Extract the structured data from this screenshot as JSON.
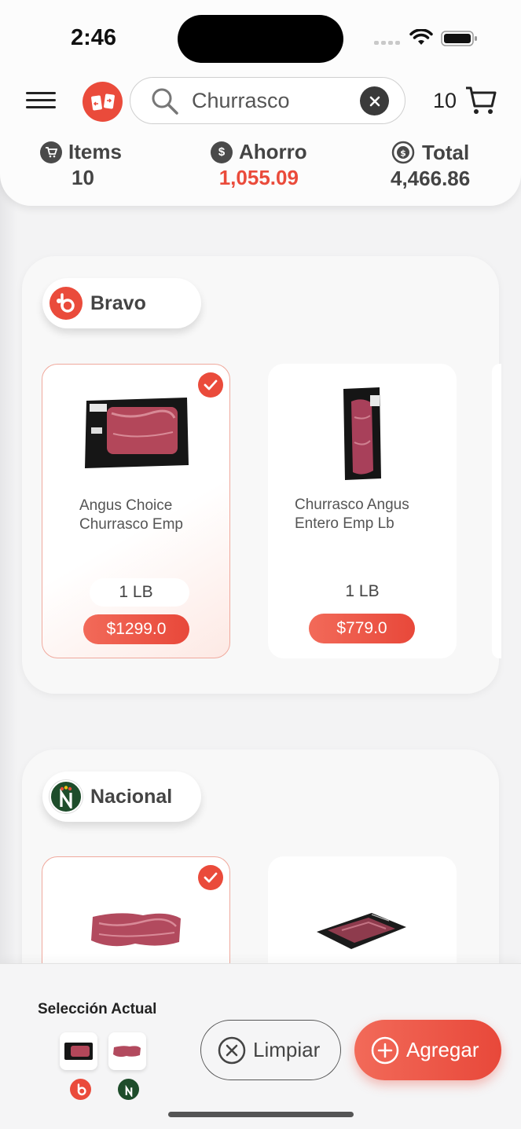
{
  "status": {
    "time": "2:46"
  },
  "header": {
    "search": {
      "value": "Churrasco",
      "placeholder": "Buscar"
    },
    "cart_count": "10",
    "stats": {
      "items": {
        "label": "Items",
        "value": "10"
      },
      "ahorro": {
        "label": "Ahorro",
        "value": "1,055.09"
      },
      "total": {
        "label": "Total",
        "value": "4,466.86"
      }
    }
  },
  "stores": [
    {
      "name": "Bravo",
      "products": [
        {
          "name": "Angus Choice Churrasco Emp",
          "unit": "1 LB",
          "price": "$1299.0",
          "selected": true
        },
        {
          "name": "Churrasco Angus Entero Emp Lb",
          "unit": "1 LB",
          "price": "$779.0",
          "selected": false
        }
      ]
    },
    {
      "name": "Nacional",
      "products": [
        {
          "selected": true
        },
        {
          "selected": false
        }
      ]
    }
  ],
  "bottom": {
    "selection_title": "Selección Actual",
    "clear_label": "Limpiar",
    "add_label": "Agregar"
  },
  "colors": {
    "accent": "#ea4b3b",
    "nacional": "#1e4d2b"
  }
}
